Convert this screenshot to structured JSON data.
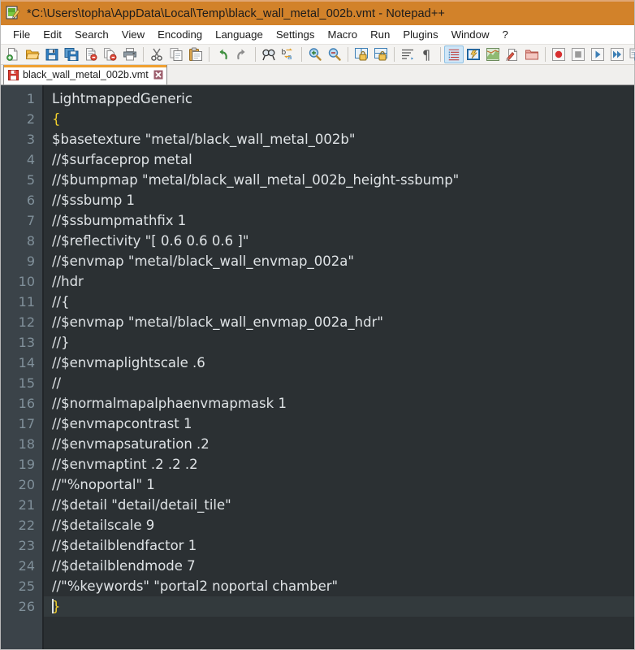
{
  "window": {
    "title": "*C:\\Users\\topha\\AppData\\Local\\Temp\\black_wall_metal_002b.vmt - Notepad++",
    "app_icon": "notepad-plus-plus-icon",
    "titlebar_color": "#d2822a"
  },
  "menubar": {
    "items": [
      {
        "label": "File"
      },
      {
        "label": "Edit"
      },
      {
        "label": "Search"
      },
      {
        "label": "View"
      },
      {
        "label": "Encoding"
      },
      {
        "label": "Language"
      },
      {
        "label": "Settings"
      },
      {
        "label": "Macro"
      },
      {
        "label": "Run"
      },
      {
        "label": "Plugins"
      },
      {
        "label": "Window"
      },
      {
        "label": "?"
      }
    ]
  },
  "toolbar": {
    "buttons": [
      {
        "name": "new-file-icon"
      },
      {
        "name": "open-file-icon"
      },
      {
        "name": "save-icon"
      },
      {
        "name": "save-all-icon"
      },
      {
        "name": "close-file-icon"
      },
      {
        "name": "close-all-files-icon"
      },
      {
        "name": "print-icon"
      },
      {
        "name": "separator"
      },
      {
        "name": "cut-icon"
      },
      {
        "name": "copy-icon"
      },
      {
        "name": "paste-icon"
      },
      {
        "name": "separator"
      },
      {
        "name": "undo-icon"
      },
      {
        "name": "redo-icon"
      },
      {
        "name": "separator"
      },
      {
        "name": "find-icon"
      },
      {
        "name": "replace-icon"
      },
      {
        "name": "separator"
      },
      {
        "name": "zoom-in-icon"
      },
      {
        "name": "zoom-out-icon"
      },
      {
        "name": "separator"
      },
      {
        "name": "sync-vertical-scroll-icon"
      },
      {
        "name": "sync-horizontal-scroll-icon"
      },
      {
        "name": "separator"
      },
      {
        "name": "word-wrap-icon"
      },
      {
        "name": "show-all-characters-icon"
      },
      {
        "name": "separator"
      },
      {
        "name": "indent-guide-icon"
      },
      {
        "name": "user-defined-language-icon"
      },
      {
        "name": "document-map-icon"
      },
      {
        "name": "function-list-icon"
      },
      {
        "name": "folder-as-workspace-icon"
      },
      {
        "name": "separator"
      },
      {
        "name": "macro-record-icon"
      },
      {
        "name": "macro-stop-icon"
      },
      {
        "name": "macro-play-icon"
      },
      {
        "name": "macro-play-multiple-icon"
      },
      {
        "name": "macro-save-icon"
      }
    ]
  },
  "tabs": [
    {
      "label": "black_wall_metal_002b.vmt",
      "icon": "unsaved-document-icon",
      "close_icon": "close-tab-icon",
      "active": true,
      "modified": true
    }
  ],
  "editor": {
    "background": "#2b3033",
    "gutter_background": "#3b4349",
    "text_color": "#dfe3e6",
    "line_number_color": "#80909a",
    "brace_color": "#f2d02c",
    "current_line": 26,
    "line_numbers": [
      1,
      2,
      3,
      4,
      5,
      6,
      7,
      8,
      9,
      10,
      11,
      12,
      13,
      14,
      15,
      16,
      17,
      18,
      19,
      20,
      21,
      22,
      23,
      24,
      25,
      26
    ],
    "lines": [
      "LightmappedGeneric",
      "{",
      "$basetexture \"metal/black_wall_metal_002b\"",
      "//$surfaceprop metal",
      "//$bumpmap \"metal/black_wall_metal_002b_height-ssbump\"",
      "//$ssbump 1",
      "//$ssbumpmathfix 1",
      "//$reflectivity \"[ 0.6 0.6 0.6 ]\"",
      "//$envmap \"metal/black_wall_envmap_002a\"",
      "//hdr",
      "//{",
      "//$envmap \"metal/black_wall_envmap_002a_hdr\"",
      "//}",
      "//$envmaplightscale .6",
      "//",
      "//$normalmapalphaenvmapmask 1",
      "//$envmapcontrast 1",
      "//$envmapsaturation .2",
      "//$envmaptint .2 .2 .2",
      "//\"%noportal\" 1",
      "//$detail \"detail/detail_tile\"",
      "//$detailscale 9",
      "//$detailblendfactor 1",
      "//$detailblendmode 7",
      "//\"%keywords\" \"portal2 noportal chamber\"",
      "}"
    ]
  }
}
